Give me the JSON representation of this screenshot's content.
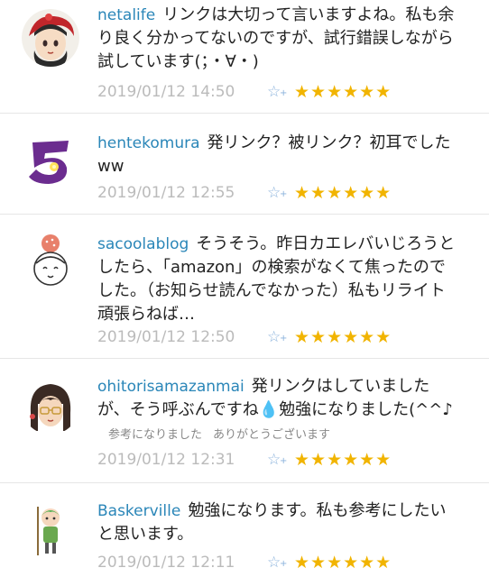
{
  "comments": [
    {
      "username": "netalife",
      "text": "リンクは大切って言いますよね。私も余り良く分かってないのですが、試行錯誤しながら試しています(；・∀・)",
      "date": "2019/01/12 14:50",
      "stars": "★★★★★★",
      "reactions": []
    },
    {
      "username": "hentekomura",
      "text": "発リンク？被リンク？初耳でしたww",
      "date": "2019/01/12 12:55",
      "stars": "★★★★★★",
      "reactions": []
    },
    {
      "username": "sacoolablog",
      "text": "そうそう。昨日カエレバいじろうとしたら、「amazon」の検索がなくて焦ったのでした。（お知らせ読んでなかった）私もリライト頑張らねば…",
      "date": "2019/01/12 12:50",
      "stars": "★★★★★★",
      "reactions": []
    },
    {
      "username": "ohitorisamazanmai",
      "text": "発リンクはしていましたが、そう呼ぶんですね💧勉強になりました(^^♪",
      "date": "2019/01/12 12:31",
      "stars": "★★★★★★",
      "reactions": [
        "参考になりました",
        "ありがとうございます"
      ]
    },
    {
      "username": "Baskerville",
      "text": "勉強になります。私も参考にしたいと思います。",
      "date": "2019/01/12 12:11",
      "stars": "★★★★★★",
      "reactions": []
    }
  ],
  "icons": {
    "add_star": "☆",
    "add_star_plus": "+"
  },
  "colors": {
    "username": "#2a86b8",
    "date": "#bbbbbb",
    "star": "#f1b400",
    "add_star": "#8ab2dc"
  }
}
